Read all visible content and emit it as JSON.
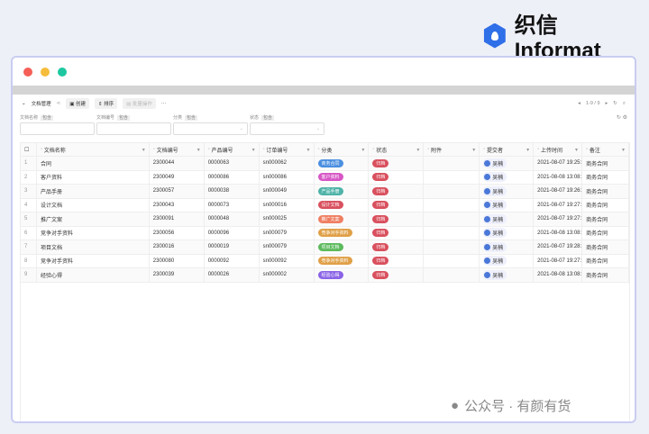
{
  "brand": {
    "name": "织信 Informat"
  },
  "watermark": "公众号 · 有颜有货",
  "toolbar": {
    "title": "文档管理",
    "create": "创建",
    "sort": "排序",
    "batch": "批量操作",
    "more": "···",
    "pagination": "1-9 / 9"
  },
  "filters": [
    {
      "label": "文档名称",
      "tag": "包含"
    },
    {
      "label": "文档编号",
      "tag": "包含"
    },
    {
      "label": "分类",
      "tag": "包含",
      "select": true
    },
    {
      "label": "状态",
      "tag": "包含",
      "select": true
    }
  ],
  "columns": [
    "文档名称",
    "文档编号",
    "产品编号",
    "订单编号",
    "分类",
    "状态",
    "附件",
    "提交者",
    "上传时间",
    "备注"
  ],
  "rows": [
    {
      "n": "1",
      "name": "合同",
      "doc": "2300044",
      "prod": "0000063",
      "order": "sn000062",
      "cat": "商务合同",
      "color": "#4a8fe0",
      "status": "归档",
      "user": "吴楠",
      "time": "2021-08-07 19:25:59",
      "note": "商务合同"
    },
    {
      "n": "2",
      "name": "客户资料",
      "doc": "2300049",
      "prod": "0000086",
      "order": "sn000086",
      "cat": "客户资料",
      "color": "#d756c6",
      "status": "归档",
      "user": "吴楠",
      "time": "2021-08-08 13:08:32",
      "note": "商务合同"
    },
    {
      "n": "3",
      "name": "产品手册",
      "doc": "2300057",
      "prod": "0000038",
      "order": "sn000049",
      "cat": "产品手册",
      "color": "#4fb3a8",
      "status": "归档",
      "user": "吴楠",
      "time": "2021-08-07 19:26:39",
      "note": "商务合同"
    },
    {
      "n": "4",
      "name": "设计文档",
      "doc": "2300043",
      "prod": "0000073",
      "order": "sn000016",
      "cat": "设计文档",
      "color": "#d9505e",
      "status": "归档",
      "user": "吴楠",
      "time": "2021-08-07 19:27:14",
      "note": "商务合同"
    },
    {
      "n": "5",
      "name": "推广文案",
      "doc": "2300091",
      "prod": "0000048",
      "order": "sn000025",
      "cat": "推广文案",
      "color": "#ef7f63",
      "status": "归档",
      "user": "吴楠",
      "time": "2021-08-07 19:27:29",
      "note": "商务合同"
    },
    {
      "n": "6",
      "name": "竞争对手资料",
      "doc": "2300056",
      "prod": "0000096",
      "order": "sn000079",
      "cat": "竞争对手资料",
      "color": "#e0a048",
      "status": "归档",
      "user": "吴楠",
      "time": "2021-08-08 13:08:33",
      "note": "商务合同"
    },
    {
      "n": "7",
      "name": "项目文档",
      "doc": "2300016",
      "prod": "0000019",
      "order": "sn000079",
      "cat": "项目文档",
      "color": "#5cba5c",
      "status": "归档",
      "user": "吴楠",
      "time": "2021-08-07 19:28:02",
      "note": "商务合同"
    },
    {
      "n": "8",
      "name": "竞争对手资料",
      "doc": "2300080",
      "prod": "0000092",
      "order": "sn000092",
      "cat": "竞争对手资料",
      "color": "#e0a048",
      "status": "归档",
      "user": "吴楠",
      "time": "2021-08-07 19:27:44",
      "note": "商务合同"
    },
    {
      "n": "9",
      "name": "经验心得",
      "doc": "2300039",
      "prod": "0000026",
      "order": "sn000002",
      "cat": "经验心得",
      "color": "#8a63e6",
      "status": "归档",
      "user": "吴楠",
      "time": "2021-08-08 13:08:33",
      "note": "商务合同"
    }
  ],
  "status_color": "#d9505e"
}
